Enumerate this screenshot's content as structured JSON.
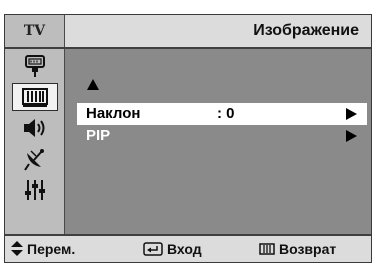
{
  "header": {
    "source_label": "TV",
    "title": "Изображение"
  },
  "sidebar": {
    "items": [
      {
        "icon": "input-icon",
        "active": false
      },
      {
        "icon": "picture-icon",
        "active": true
      },
      {
        "icon": "sound-icon",
        "active": false
      },
      {
        "icon": "channel-icon",
        "active": false
      },
      {
        "icon": "setup-icon",
        "active": false
      }
    ]
  },
  "menu": {
    "items": [
      {
        "label": "Наклон",
        "value": ": 0",
        "selected": true
      },
      {
        "label": "PIP",
        "value": "",
        "selected": false
      }
    ]
  },
  "footer": {
    "move_label": "Перем.",
    "enter_label": "Вход",
    "return_label": "Возврат"
  },
  "colors": {
    "panel_bg": "#8a8a8a",
    "header_bg": "#dcdcdc",
    "sidebar_bg": "#bdbdbd",
    "highlight": "#ffffff"
  }
}
